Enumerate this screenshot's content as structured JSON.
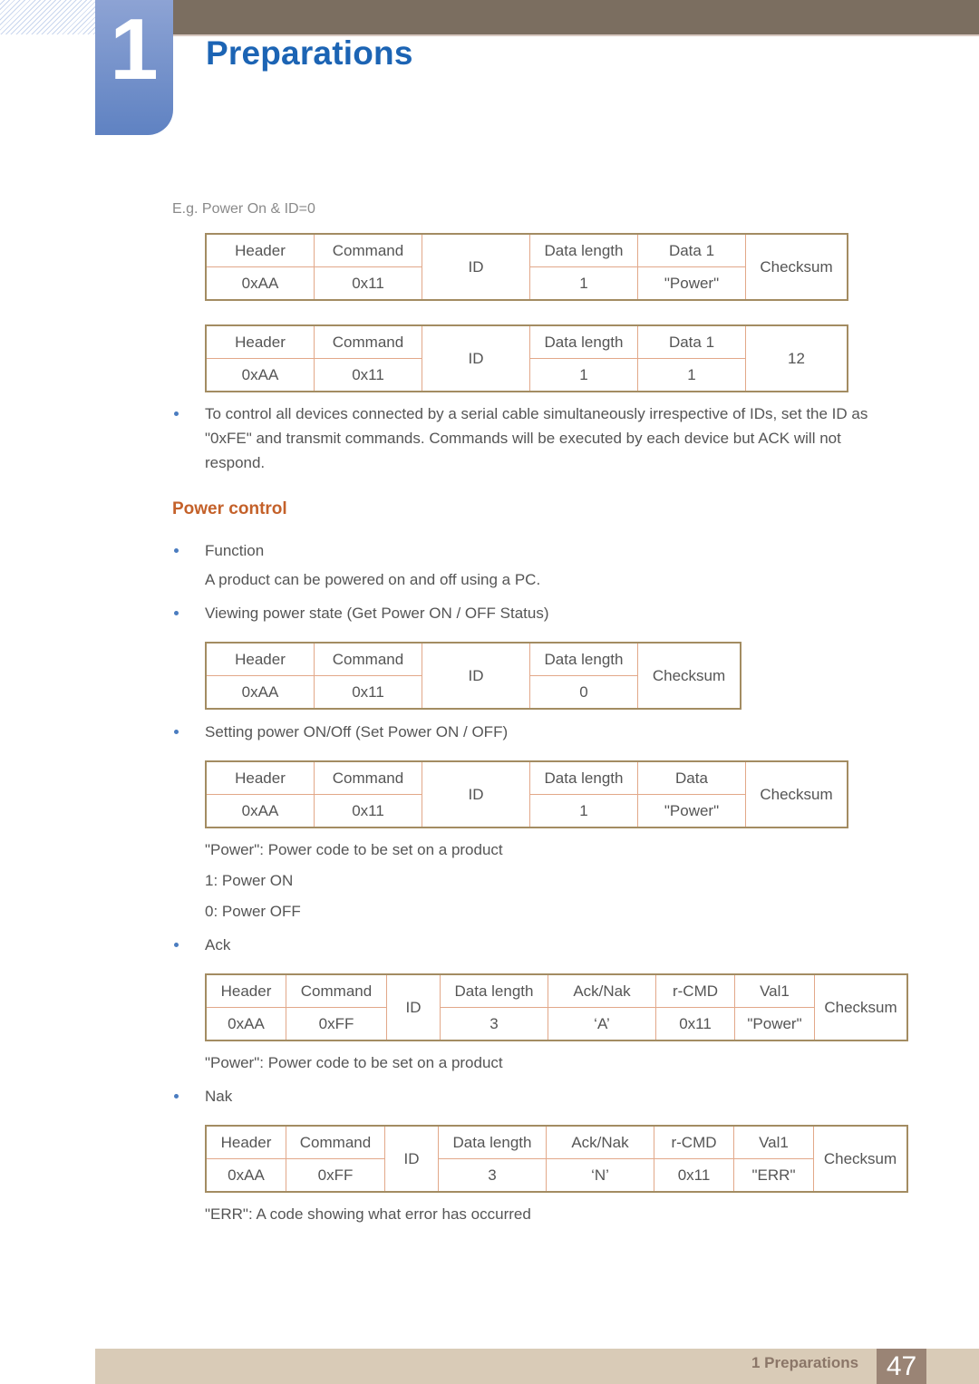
{
  "chapter": {
    "number": "1",
    "title": "Preparations"
  },
  "caption": "E.g. Power On & ID=0",
  "tables": {
    "example1": {
      "headers": [
        "Header",
        "Command",
        "ID",
        "Data length",
        "Data 1",
        "Checksum"
      ],
      "values": [
        "0xAA",
        "0x11",
        "1",
        "\"Power\""
      ]
    },
    "example2": {
      "headers": [
        "Header",
        "Command",
        "ID",
        "Data length",
        "Data 1",
        "12"
      ],
      "values": [
        "0xAA",
        "0x11",
        "1",
        "1"
      ]
    },
    "get_power": {
      "headers": [
        "Header",
        "Command",
        "ID",
        "Data length",
        "Checksum"
      ],
      "values": [
        "0xAA",
        "0x11",
        "0"
      ]
    },
    "set_power": {
      "headers": [
        "Header",
        "Command",
        "ID",
        "Data length",
        "Data",
        "Checksum"
      ],
      "values": [
        "0xAA",
        "0x11",
        "1",
        "\"Power\""
      ]
    },
    "ack": {
      "headers": [
        "Header",
        "Command",
        "ID",
        "Data length",
        "Ack/Nak",
        "r-CMD",
        "Val1",
        "Checksum"
      ],
      "values": [
        "0xAA",
        "0xFF",
        "3",
        "‘A’",
        "0x11",
        "\"Power\""
      ]
    },
    "nak": {
      "headers": [
        "Header",
        "Command",
        "ID",
        "Data length",
        "Ack/Nak",
        "r-CMD",
        "Val1",
        "Checksum"
      ],
      "values": [
        "0xAA",
        "0xFF",
        "3",
        "‘N’",
        "0x11",
        "\"ERR\""
      ]
    }
  },
  "bullets": {
    "broadcast": "To control all devices connected by a serial cable simultaneously irrespective of IDs, set the ID as \"0xFE\" and transmit commands. Commands will be executed by each device but ACK will not respond.",
    "function": "Function",
    "function_desc": "A product can be powered on and off using a PC.",
    "viewing": "Viewing power state (Get Power ON / OFF Status)",
    "setting": "Setting power ON/Off (Set Power ON / OFF)",
    "ack": "Ack",
    "nak": "Nak"
  },
  "section_heading": "Power control",
  "notes": {
    "power_code": "\"Power\": Power code to be set on a product",
    "power_on": "1: Power ON",
    "power_off": "0: Power OFF",
    "power_code_ack": "\"Power\": Power code to be set on a product",
    "err_code": "\"ERR\": A code showing what error has occurred"
  },
  "footer": {
    "section": "1 Preparations",
    "page": "47"
  }
}
